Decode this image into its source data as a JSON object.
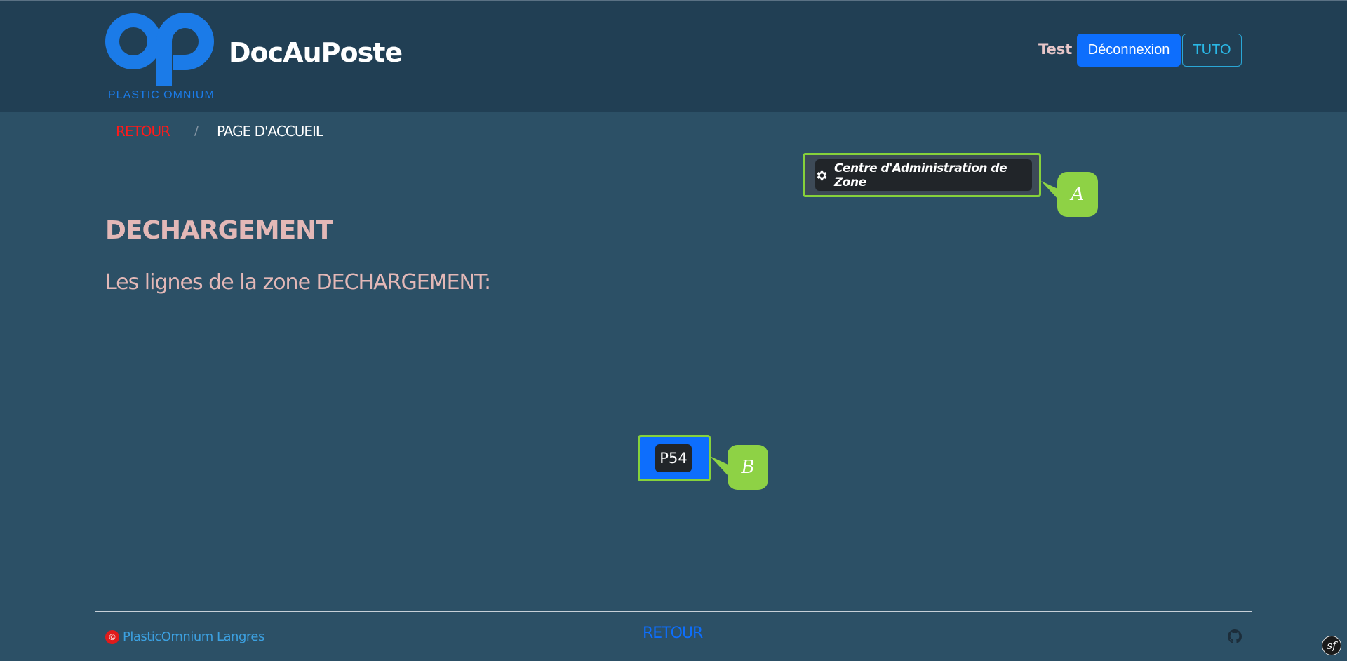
{
  "header": {
    "app_title": "DocAuPoste",
    "logo_caption": "PLASTIC OMNIUM",
    "user_name": "Test",
    "logout_label": "Déconnexion",
    "tuto_label": "TUTO"
  },
  "breadcrumb": {
    "back_label": "RETOUR",
    "separator": "/",
    "home_label": "PAGE D'ACCUEIL"
  },
  "admin": {
    "button_label": "Centre d'Administration de Zone",
    "icon": "gear-icon",
    "callout": "A"
  },
  "zone": {
    "title": "DECHARGEMENT",
    "subtitle": "Les lignes de la zone DECHARGEMENT:",
    "lines": [
      {
        "label": "P54",
        "callout": "B"
      }
    ]
  },
  "footer": {
    "company": "PlasticOmnium Langres",
    "back_label": "RETOUR",
    "copyright_icon": "copyright-icon",
    "github_icon": "github-icon",
    "symfony_icon": "symfony-icon",
    "symfony_glyph": "sf"
  },
  "colors": {
    "background": "#2c5066",
    "header": "#213f54",
    "primary": "#0d6efd",
    "accent_red": "#ff1a1a",
    "heading_pink": "#e3b8b7",
    "annotation_green": "#86d13b"
  }
}
